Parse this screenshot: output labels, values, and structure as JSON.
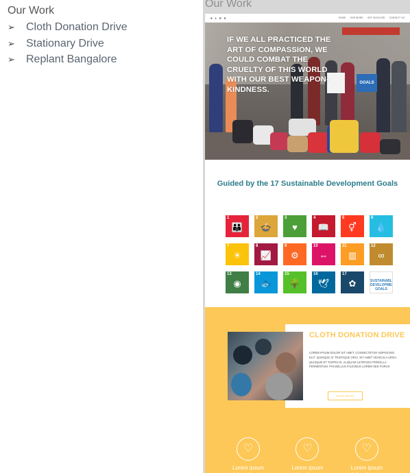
{
  "notes": {
    "title": "Our Work",
    "items": [
      {
        "bullet": "➢",
        "label": "Cloth Donation Drive"
      },
      {
        "bullet": "➢",
        "label": "Stationary Drive"
      },
      {
        "bullet": "➢",
        "label": "Replant Bangalore"
      }
    ]
  },
  "preview": {
    "title": "Our Work",
    "nav": {
      "logo_letters": [
        "S",
        "L",
        "E",
        "S"
      ],
      "menu": [
        "HOME",
        "OUR WORK",
        "GET INVOLVED",
        "CONTACT US"
      ]
    },
    "hero": {
      "quote": "If we all practiced the art of compassion, we could combat the cruelty of this world with our best weapon- kindness.",
      "placard_text": "GOALS"
    },
    "sdg": {
      "heading": "Guided by the 17 Sustainable Development Goals",
      "tiles": [
        {
          "num": "1",
          "glyph": "👪",
          "color": "#e5243b"
        },
        {
          "num": "2",
          "glyph": "🍲",
          "color": "#dda63a"
        },
        {
          "num": "3",
          "glyph": "♥",
          "color": "#4c9f38"
        },
        {
          "num": "4",
          "glyph": "📖",
          "color": "#c5192d"
        },
        {
          "num": "5",
          "glyph": "⚥",
          "color": "#ff3a21"
        },
        {
          "num": "6",
          "glyph": "💧",
          "color": "#26bde2"
        },
        {
          "num": "7",
          "glyph": "☀",
          "color": "#fcc30b"
        },
        {
          "num": "8",
          "glyph": "📈",
          "color": "#a21942"
        },
        {
          "num": "9",
          "glyph": "⚙",
          "color": "#fd6925"
        },
        {
          "num": "10",
          "glyph": "⇔",
          "color": "#dd1367"
        },
        {
          "num": "11",
          "glyph": "▥",
          "color": "#fd9d24"
        },
        {
          "num": "12",
          "glyph": "∞",
          "color": "#bf8b2e"
        },
        {
          "num": "13",
          "glyph": "◉",
          "color": "#3f7e44"
        },
        {
          "num": "14",
          "glyph": "🐟",
          "color": "#0a97d9"
        },
        {
          "num": "15",
          "glyph": "🌳",
          "color": "#56c02b"
        },
        {
          "num": "16",
          "glyph": "🕊",
          "color": "#00689d"
        },
        {
          "num": "17",
          "glyph": "✿",
          "color": "#19486a"
        },
        {
          "num": "",
          "glyph": "SUSTAINABLE DEVELOPMENT GOALS",
          "color": "#ffffff"
        }
      ]
    },
    "drive": {
      "title": "CLOTH DONATION DRIVE",
      "text": "LOREM IPSUM DOLOR SIT AMET, CONSECTETUR ADIPISCING ELIT. QUISQUE AT TRISTIQUE ORCI. SIT AMET VEHICULA URNA. QUISQUE ET TURPIS ID. ALIQUAM ULTRICES FRINGILLA FERMENTUM. PHASELLUS FAUCIBUS LOREM SED PURUS",
      "button": "READ MORE"
    },
    "icons": [
      {
        "label": "Lorem ipsum dolor sit amet"
      },
      {
        "label": "Lorem ipsum dolor sit amet"
      },
      {
        "label": "Lorem ipsum dolor sit amet"
      }
    ]
  },
  "colors": {
    "accent": "#fdc857",
    "heading_teal": "#2c7d8c"
  }
}
